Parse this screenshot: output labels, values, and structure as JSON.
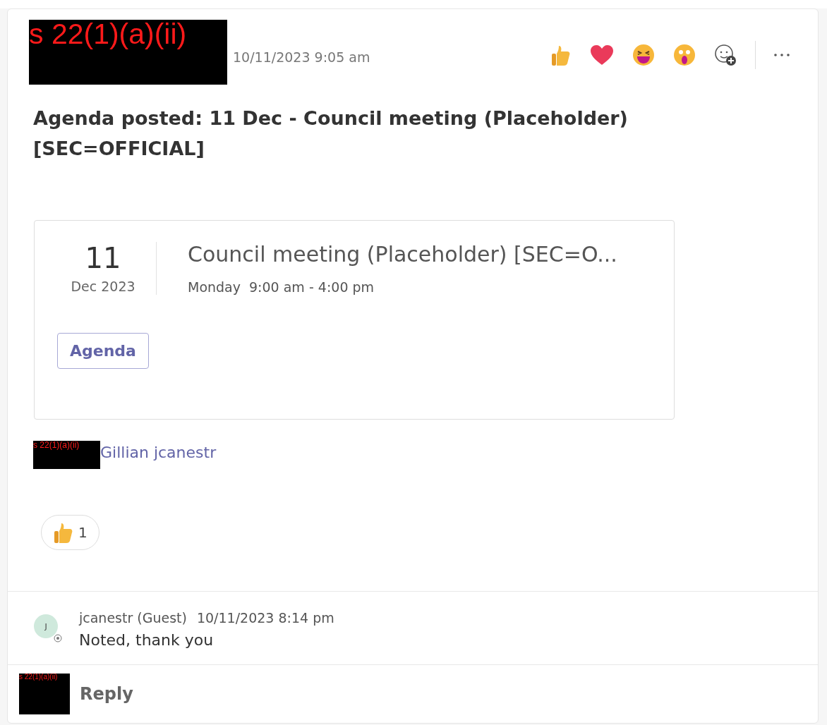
{
  "post": {
    "author_redaction": "s 22(1)(a)(ii)",
    "timestamp": "10/11/2023 9:05 am",
    "title": "Agenda posted: 11 Dec - Council meeting (Placeholder) [SEC=OFFICIAL]",
    "event": {
      "day": "11",
      "month_year": "Dec 2023",
      "title": "Council meeting (Placeholder) [SEC=O...",
      "weekday": "Monday",
      "time": "9:00 am - 4:00 pm",
      "button": "Agenda"
    },
    "mention_redaction": "s 22(1)(a)(ii)",
    "mention": "Gillian jcanestr",
    "reaction_count": "1"
  },
  "reply": {
    "avatar": "J",
    "author": "jcanestr (Guest)",
    "timestamp": "10/11/2023 8:14 pm",
    "text": "Noted, thank you"
  },
  "composer": {
    "redaction": "s 22(1)(a)(ii)",
    "label": "Reply"
  }
}
